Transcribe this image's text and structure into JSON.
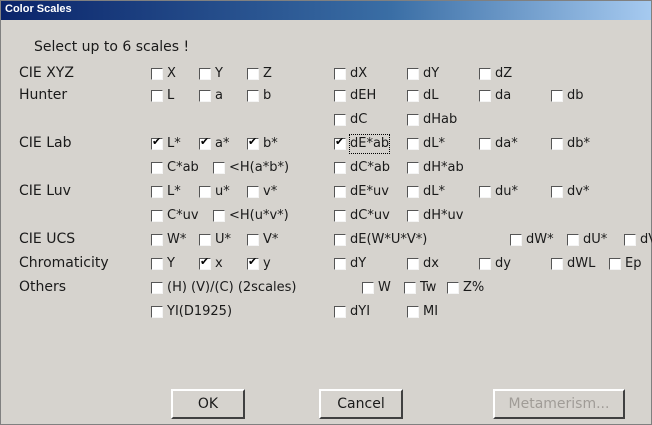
{
  "window": {
    "title": "Color Scales"
  },
  "prompt": "Select up to 6 scales !",
  "rows": [
    {
      "label": "CIE XYZ",
      "lines": [
        [
          {
            "text": "X",
            "checked": false
          },
          {
            "text": "Y",
            "checked": false
          },
          {
            "text": "Z",
            "checked": false
          },
          {
            "text": "dX",
            "checked": false
          },
          {
            "text": "dY",
            "checked": false
          },
          {
            "text": "dZ",
            "checked": false
          }
        ]
      ]
    },
    {
      "label": "Hunter",
      "lines": [
        [
          {
            "text": "L",
            "checked": false
          },
          {
            "text": "a",
            "checked": false
          },
          {
            "text": "b",
            "checked": false
          },
          {
            "text": "dEH",
            "checked": false
          },
          {
            "text": "dL",
            "checked": false
          },
          {
            "text": "da",
            "checked": false
          },
          {
            "text": "db",
            "checked": false
          }
        ],
        [
          {
            "text": "dC",
            "checked": false
          },
          {
            "text": "dHab",
            "checked": false
          }
        ]
      ]
    },
    {
      "label": "CIE Lab",
      "lines": [
        [
          {
            "text": "L*",
            "checked": true
          },
          {
            "text": "a*",
            "checked": true
          },
          {
            "text": "b*",
            "checked": true
          },
          {
            "text": "dE*ab",
            "checked": true
          },
          {
            "text": "dL*",
            "checked": false
          },
          {
            "text": "da*",
            "checked": false
          },
          {
            "text": "db*",
            "checked": false
          }
        ],
        [
          {
            "text": "C*ab",
            "checked": false
          },
          {
            "text": "<H(a*b*)",
            "checked": false
          },
          {
            "text": "dC*ab",
            "checked": false
          },
          {
            "text": "dH*ab",
            "checked": false
          }
        ]
      ]
    },
    {
      "label": "CIE Luv",
      "lines": [
        [
          {
            "text": "L*",
            "checked": false
          },
          {
            "text": "u*",
            "checked": false
          },
          {
            "text": "v*",
            "checked": false
          },
          {
            "text": "dE*uv",
            "checked": false
          },
          {
            "text": "dL*",
            "checked": false
          },
          {
            "text": "du*",
            "checked": false
          },
          {
            "text": "dv*",
            "checked": false
          }
        ],
        [
          {
            "text": "C*uv",
            "checked": false
          },
          {
            "text": "<H(u*v*)",
            "checked": false
          },
          {
            "text": "dC*uv",
            "checked": false
          },
          {
            "text": "dH*uv",
            "checked": false
          }
        ]
      ]
    },
    {
      "label": "CIE UCS",
      "lines": [
        [
          {
            "text": "W*",
            "checked": false
          },
          {
            "text": "U*",
            "checked": false
          },
          {
            "text": "V*",
            "checked": false
          },
          {
            "text": "dE(W*U*V*)",
            "checked": false
          },
          {
            "text": "dW*",
            "checked": false
          },
          {
            "text": "dU*",
            "checked": false
          },
          {
            "text": "dV*",
            "checked": false
          }
        ]
      ]
    },
    {
      "label": "Chromaticity",
      "lines": [
        [
          {
            "text": "Y",
            "checked": false
          },
          {
            "text": "x",
            "checked": true
          },
          {
            "text": "y",
            "checked": true
          },
          {
            "text": "dY",
            "checked": false
          },
          {
            "text": "dx",
            "checked": false
          },
          {
            "text": "dy",
            "checked": false
          },
          {
            "text": "dWL",
            "checked": false
          },
          {
            "text": "Ep",
            "checked": false
          }
        ]
      ]
    },
    {
      "label": "Others",
      "lines": [
        [
          {
            "text": "(H) (V)/(C) (2scales)",
            "checked": false
          },
          {
            "text": "W",
            "checked": false
          },
          {
            "text": "Tw",
            "checked": false
          },
          {
            "text": "Z%",
            "checked": false
          }
        ],
        [
          {
            "text": "YI(D1925)",
            "checked": false
          },
          {
            "text": "dYI",
            "checked": false
          },
          {
            "text": "MI",
            "checked": false
          }
        ]
      ]
    }
  ],
  "buttons": {
    "ok": "OK",
    "cancel": "Cancel",
    "metamerism": "Metamerism..."
  }
}
